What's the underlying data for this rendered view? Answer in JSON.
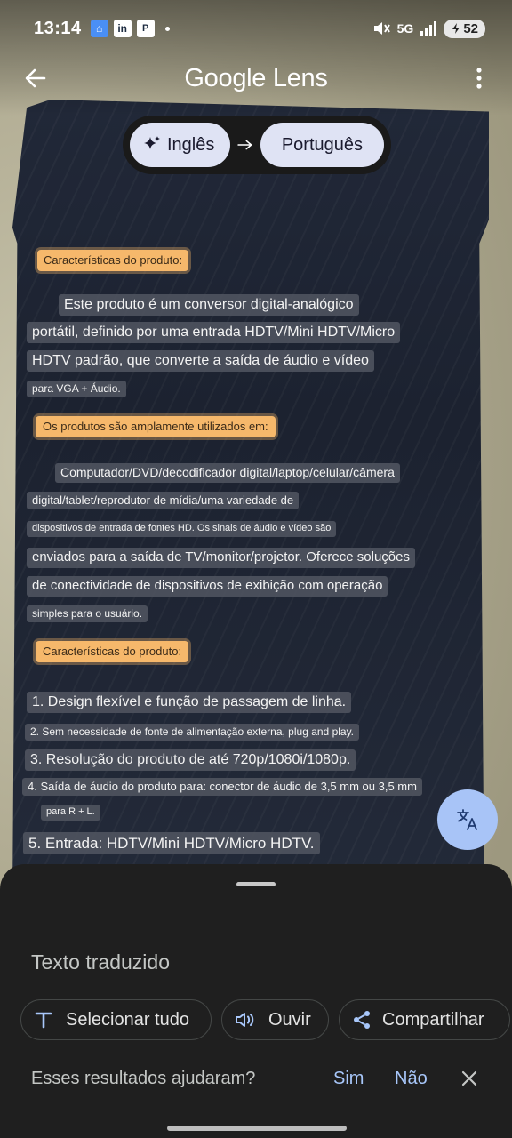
{
  "status_bar": {
    "time": "13:14",
    "network_label": "5G",
    "battery": "52"
  },
  "app_bar": {
    "title": "Google Lens"
  },
  "language": {
    "source": "Inglês",
    "target": "Português"
  },
  "overlay_lines": [
    "Características do produto:",
    "Este produto é um conversor digital-analógico",
    "portátil, definido por uma entrada HDTV/Mini HDTV/Micro",
    "HDTV padrão, que converte a saída de áudio e vídeo",
    "para VGA + Áudio.",
    "Os produtos são amplamente utilizados em:",
    "Computador/DVD/decodificador digital/laptop/celular/câmera",
    "digital/tablet/reprodutor de mídia/uma variedade de",
    "dispositivos de entrada de fontes HD. Os sinais de áudio e vídeo são",
    "enviados para a saída de TV/monitor/projetor. Oferece soluções",
    "de conectividade de dispositivos de exibição com operação",
    "simples para o usuário.",
    "Características do produto:",
    "1. Design flexível e função de passagem de linha.",
    "2. Sem necessidade de fonte de alimentação externa, plug and play.",
    "3. Resolução do produto de até 720p/1080i/1080p.",
    "4. Saída de áudio do produto para: conector de áudio de 3,5 mm ou 3,5 mm",
    "para R + L.",
    "5. Entrada: HDTV/Mini HDTV/Micro HDTV."
  ],
  "sheet": {
    "title": "Texto traduzido",
    "select_all": "Selecionar tudo",
    "listen": "Ouvir",
    "share": "Compartilhar",
    "feedback_question": "Esses resultados ajudaram?",
    "yes": "Sim",
    "no": "Não"
  },
  "icons": {
    "back": "arrow-left-icon",
    "more": "more-vert-icon",
    "sparkle": "sparkle-icon",
    "arrow": "arrow-right-icon",
    "translate": "translate-icon",
    "text": "text-icon",
    "speaker": "speaker-icon",
    "share": "share-icon",
    "close": "close-icon"
  },
  "colors": {
    "highlight": "#f6b86b",
    "fab": "#a8c4f7",
    "link": "#a8c7fa",
    "sheet_bg": "#1f1f1f"
  }
}
